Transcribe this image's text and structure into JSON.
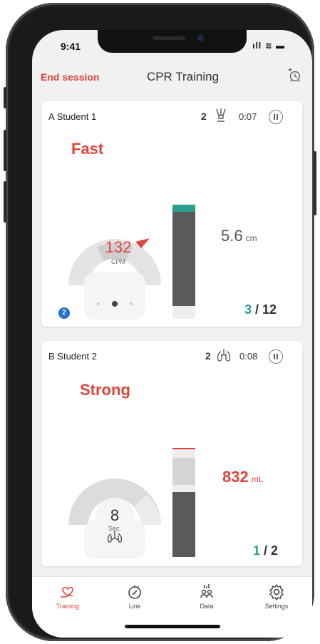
{
  "status_bar": {
    "time": "9:41",
    "icons": "ıll ≋ ▬"
  },
  "header": {
    "end_session": "End session",
    "title": "CPR Training"
  },
  "colors": {
    "accent": "#e0463b",
    "good": "#2a9d8f",
    "badge": "#1f6fcf"
  },
  "cards": [
    {
      "student": "A Student 1",
      "cycle_count": "2",
      "timer": "0:07",
      "feedback": "Fast",
      "rate_value": "132",
      "rate_unit": "CPM",
      "depth_value": "5.6",
      "depth_unit": "cm",
      "score_done": "3",
      "score_total": "/ 12",
      "badge": "2"
    },
    {
      "student": "B Student 2",
      "cycle_count": "2",
      "timer": "0:08",
      "feedback": "Strong",
      "gauge_value": "8",
      "gauge_unit": "Sec.",
      "volume_value": "832",
      "volume_unit": "mL",
      "score_done": "1",
      "score_total": "/ 2"
    }
  ],
  "tabs": [
    {
      "label": "Training",
      "icon": "heart-hand-icon",
      "active": true
    },
    {
      "label": "Link",
      "icon": "link-icon"
    },
    {
      "label": "Data",
      "icon": "people-data-icon"
    },
    {
      "label": "Settings",
      "icon": "gear-icon"
    }
  ]
}
